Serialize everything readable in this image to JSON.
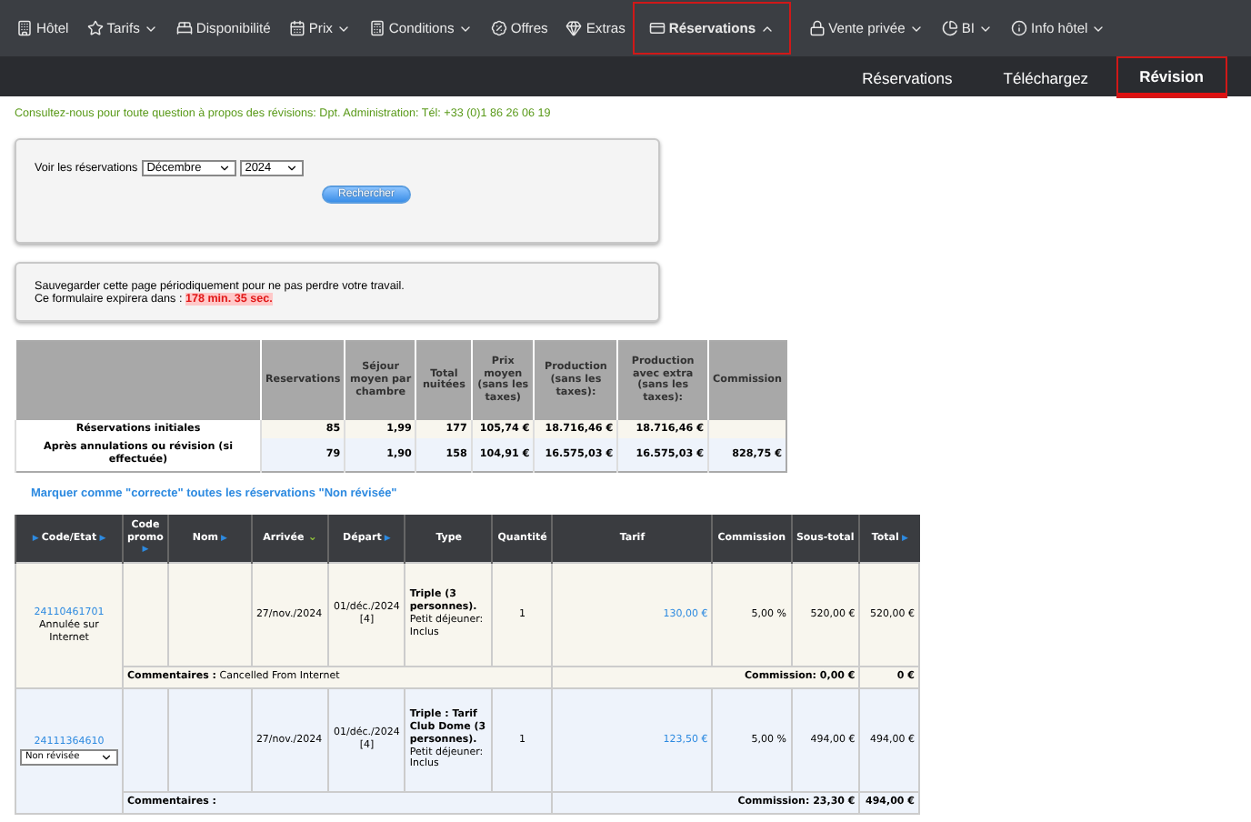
{
  "nav": {
    "items": [
      {
        "label": "Hôtel",
        "has_menu": false,
        "selected": false
      },
      {
        "label": "Tarifs",
        "has_menu": true,
        "expanded": false,
        "selected": false
      },
      {
        "label": "Disponibilité",
        "has_menu": false,
        "selected": false
      },
      {
        "label": "Prix",
        "has_menu": true,
        "expanded": false,
        "selected": false
      },
      {
        "label": "Conditions",
        "has_menu": true,
        "expanded": false,
        "selected": false
      },
      {
        "label": "Offres",
        "has_menu": false,
        "selected": false
      },
      {
        "label": "Extras",
        "has_menu": false,
        "selected": false
      },
      {
        "label": "Réservations",
        "has_menu": true,
        "expanded": true,
        "selected": true
      },
      {
        "label": "Vente privée",
        "has_menu": true,
        "expanded": false,
        "selected": false
      },
      {
        "label": "BI",
        "has_menu": true,
        "expanded": false,
        "selected": false
      },
      {
        "label": "Info hôtel",
        "has_menu": true,
        "expanded": false,
        "selected": false
      }
    ]
  },
  "subnav": {
    "items": [
      {
        "label": "Réservations",
        "selected": false
      },
      {
        "label": "Téléchargez",
        "selected": false
      },
      {
        "label": "Révision",
        "selected": true
      }
    ]
  },
  "contact_notice": "Consultez-nous pour toute question à propos des révisions: Dpt. Administration: Tél: +33 (0)1 86 26 06 19",
  "search_form": {
    "label": "Voir les réservations",
    "month": "Décembre",
    "year": "2024",
    "button": "Rechercher"
  },
  "save_notice": {
    "line_1": "Sauvegarder cette page périodiquement pour ne pas perdre votre travail.",
    "line_2": "Ce formulaire expirera dans :",
    "countdown": "178 min. 35 sec."
  },
  "summary": {
    "columns": [
      "Reservations",
      "Séjour moyen par chambre",
      "Total nuitées",
      "Prix moyen (sans les taxes)",
      "Production (sans les taxes):",
      "Production avec extra (sans les taxes):",
      "Commission"
    ],
    "rows": [
      {
        "label": "Réservations initiales",
        "values": [
          "85",
          "1,99",
          "177",
          "105,74 €",
          "18.716,46 €",
          "18.716,46 €"
        ]
      },
      {
        "label": "Après annulations ou révision (si effectuée)",
        "values": [
          "79",
          "1,90",
          "158",
          "104,91 €",
          "16.575,03 €",
          "16.575,03 €",
          "828,75 €"
        ]
      }
    ]
  },
  "mark_all_link": "Marquer comme \"correcte\" toutes les réservations \"Non révisée\"",
  "reservations": {
    "columns": [
      {
        "label": "Code/Etat",
        "marker_before": "▶",
        "marker": "▶",
        "sorted": false
      },
      {
        "label": "Code promo",
        "marker": "▶",
        "sorted": false
      },
      {
        "label": "Nom",
        "marker": "▶",
        "sorted": false
      },
      {
        "label": "Arrivée",
        "marker": "⌄",
        "sorted": true
      },
      {
        "label": "Départ",
        "marker": "▶",
        "sorted": false
      },
      {
        "label": "Type"
      },
      {
        "label": "Quantité"
      },
      {
        "label": "Tarif"
      },
      {
        "label": "Commission"
      },
      {
        "label": "Sous-total"
      },
      {
        "label": "Total",
        "marker": "▶",
        "sorted": false
      }
    ],
    "rows": [
      {
        "kind": "cancelled",
        "code": "24110461701",
        "status": "Annulée sur Internet",
        "arrival": "27/nov./2024",
        "departure": "01/déc./2024",
        "nights": "[4]",
        "type_title": "Triple (3 personnes).",
        "type_detail": "Petit déjeuner: Inclus",
        "quantity": "1",
        "tariff": "130,00  €",
        "commission": "5,00 %",
        "subtotal": "520,00 €",
        "total": "520,00 €",
        "comments_label": "Commentaires :",
        "comments": "Cancelled From Internet",
        "commission_total": "Commission: 0,00 €",
        "row_total": "0 €"
      },
      {
        "kind": "pending",
        "code": "24111364610",
        "status": "Non révisée",
        "arrival": "27/nov./2024",
        "departure": "01/déc./2024",
        "nights": "[4]",
        "type_title": "Triple : Tarif Club Dome (3 personnes).",
        "type_detail": "Petit déjeuner: Inclus",
        "quantity": "1",
        "tariff": "123,50  €",
        "commission": "5,00 %",
        "subtotal": "494,00 €",
        "total": "494,00 €",
        "comments_label": "Commentaires :",
        "commission_total": "Commission: 23,30 €",
        "row_total": "494,00 €"
      }
    ]
  }
}
